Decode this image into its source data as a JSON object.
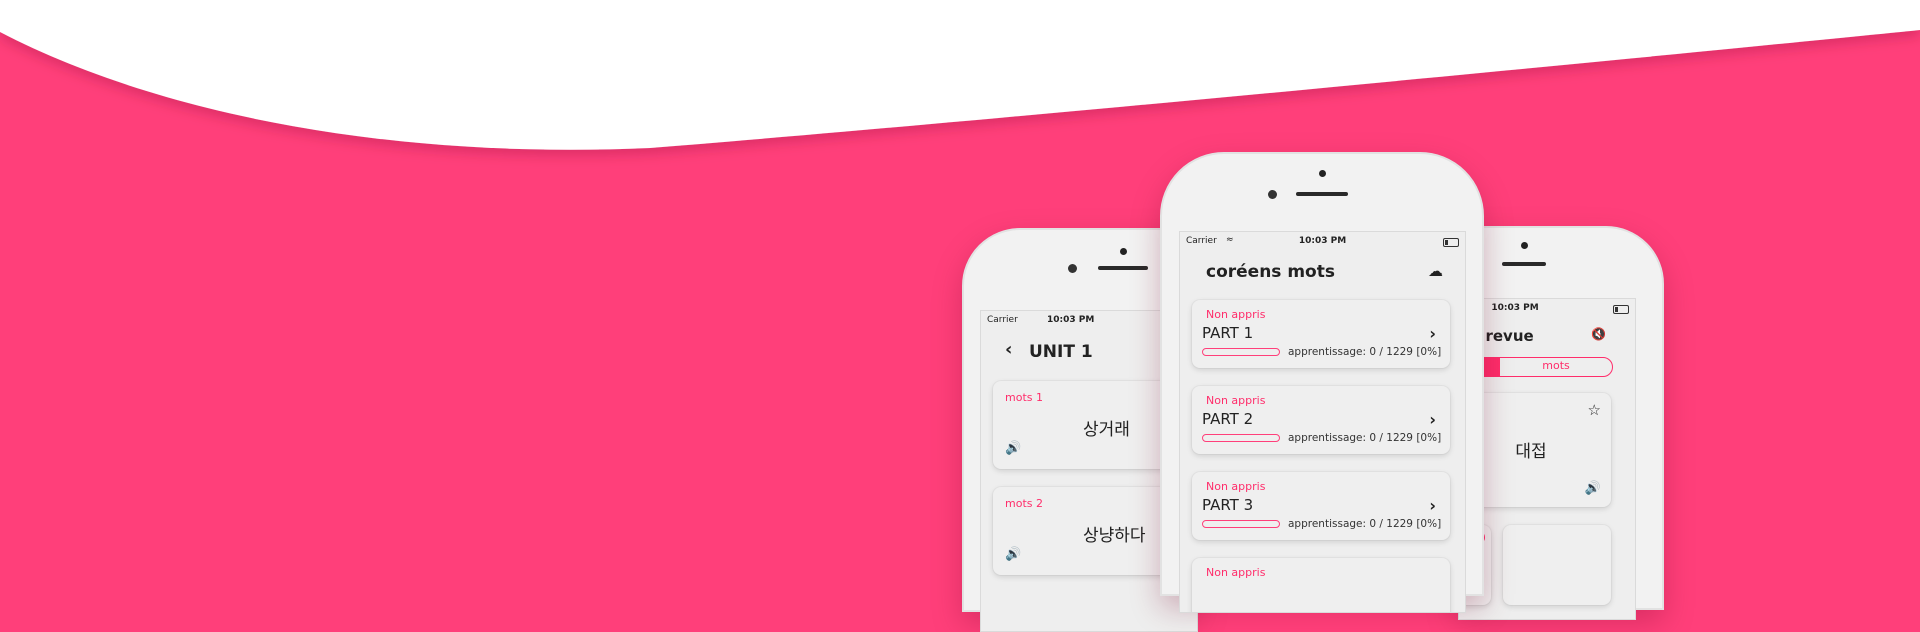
{
  "colors": {
    "background": "#ff3f7a",
    "accent": "#ff2d6b",
    "wave": "#ffffff"
  },
  "left_phone": {
    "status": {
      "carrier": "Carrier",
      "time": "10:03 PM"
    },
    "title": "UNIT 1",
    "back_icon": "chevron-left-icon",
    "cards": [
      {
        "label": "mots 1",
        "word": "상거래",
        "sound_icon": "speaker-icon"
      },
      {
        "label": "mots 2",
        "word": "상냥하다",
        "sound_icon": "speaker-icon"
      }
    ]
  },
  "center_phone": {
    "status": {
      "carrier": "Carrier",
      "time": "10:03 PM"
    },
    "title": "coréens mots",
    "cloud_icon": "cloud-icon",
    "parts": [
      {
        "badge": "Non appris",
        "name": "PART 1",
        "progress_text": "apprentissage: 0 / 1229 [0%]",
        "progress": 0
      },
      {
        "badge": "Non appris",
        "name": "PART 2",
        "progress_text": "apprentissage: 0 / 1229 [0%]",
        "progress": 0
      },
      {
        "badge": "Non appris",
        "name": "PART 3",
        "progress_text": "apprentissage: 0 / 1229 [0%]",
        "progress": 0
      },
      {
        "badge": "Non appris"
      }
    ]
  },
  "right_phone": {
    "status": {
      "time": "10:03 PM"
    },
    "title": "la revue",
    "mute_icon": "speaker-mute-icon",
    "segment_label": "mots",
    "word": "대접",
    "star_icon": "star-icon",
    "sound_icon": "speaker-icon",
    "wrong_icon": "close-circle-icon"
  }
}
